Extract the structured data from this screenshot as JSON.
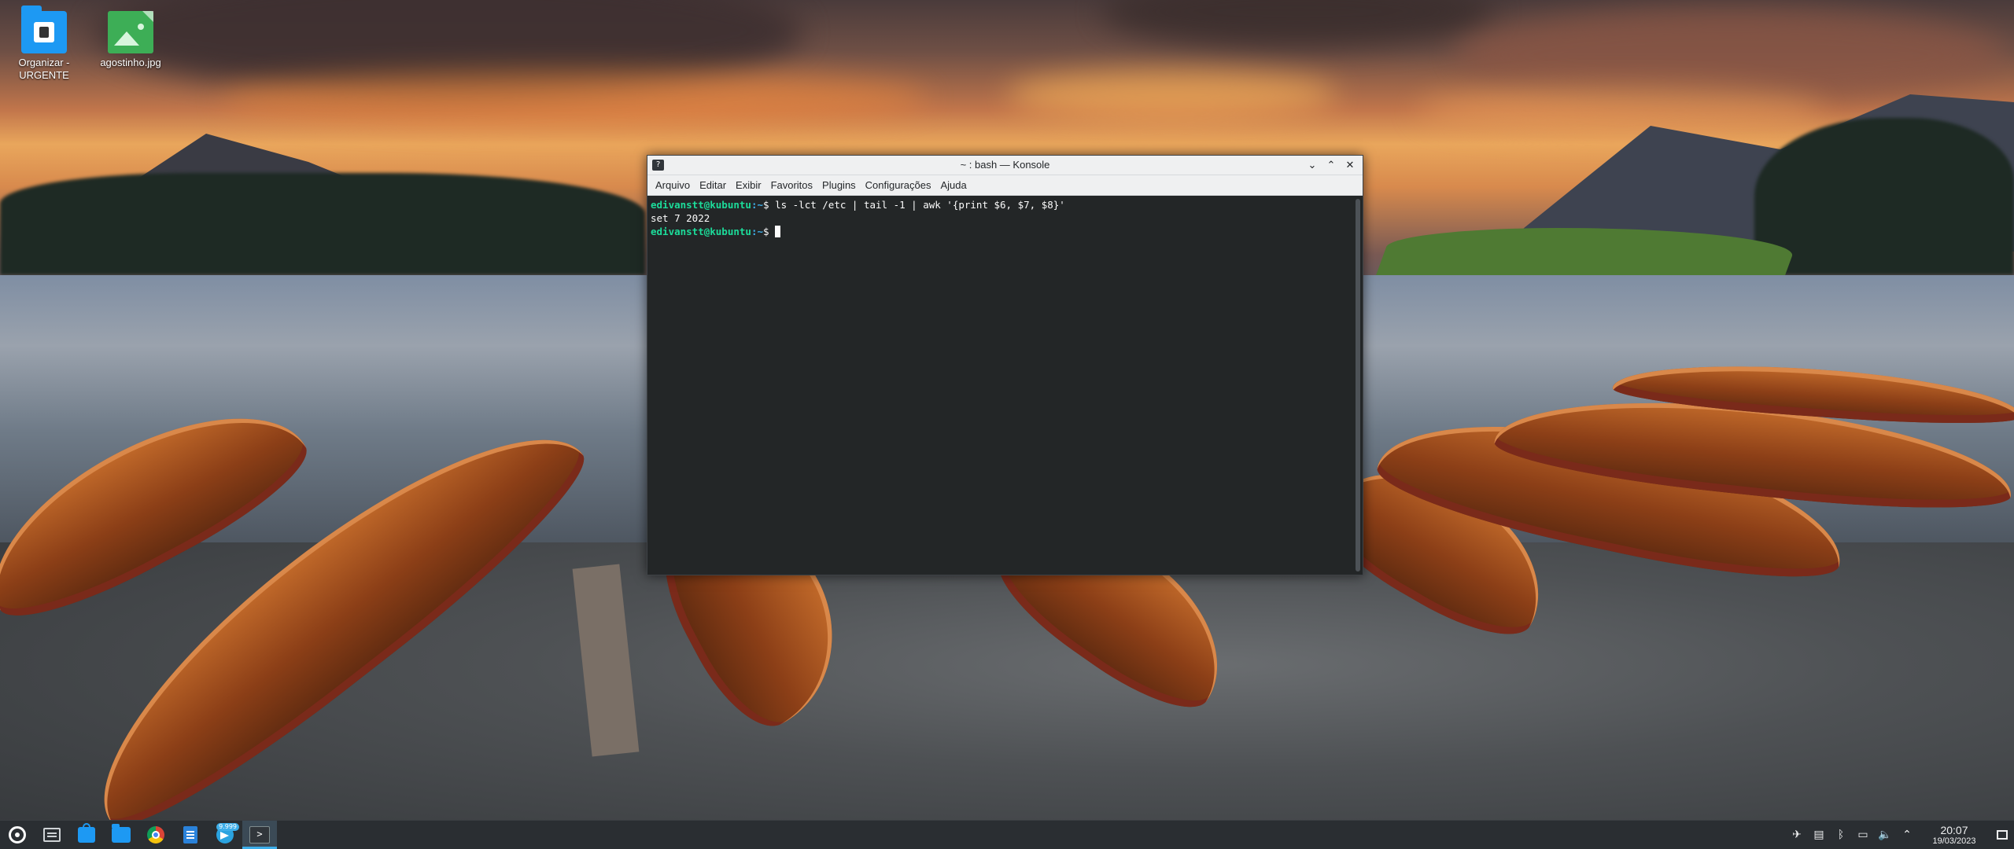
{
  "desktop": {
    "icons": [
      {
        "label": "Organizar - URGENTE",
        "icon": "folder-icon"
      },
      {
        "label": "agostinho.jpg",
        "icon": "image-file-icon"
      }
    ]
  },
  "window": {
    "title": "~ : bash — Konsole",
    "app_icon_glyph": "?",
    "buttons": {
      "minimize": "⌄",
      "maximize": "⌃",
      "close": "✕"
    },
    "menu": [
      "Arquivo",
      "Editar",
      "Exibir",
      "Favoritos",
      "Plugins",
      "Configurações",
      "Ajuda"
    ]
  },
  "terminal": {
    "prompt_user": "edivanstt@kubuntu",
    "prompt_path": ":~",
    "prompt_symbol": "$ ",
    "command": "ls -lct /etc | tail -1 | awk '{print $6, $7, $8}'",
    "output": "set 7 2022",
    "colors": {
      "background": "#232627",
      "foreground": "#fcfcfc",
      "user": "#1cdc9a",
      "path": "#3daee9"
    }
  },
  "taskbar": {
    "items": [
      {
        "name": "application-launcher",
        "icon": "launcher-icon"
      },
      {
        "name": "system-settings",
        "icon": "system-icon"
      },
      {
        "name": "discover-store",
        "icon": "store-icon"
      },
      {
        "name": "dolphin-files",
        "icon": "folder-icon"
      },
      {
        "name": "google-chrome",
        "icon": "chrome-icon"
      },
      {
        "name": "documents",
        "icon": "document-icon"
      },
      {
        "name": "telegram",
        "icon": "telegram-icon",
        "badge": "9.999"
      },
      {
        "name": "konsole",
        "icon": "terminal-icon",
        "active": true,
        "glyph": ">"
      }
    ],
    "tray": {
      "icons": [
        "telegram-tray-icon",
        "clipboard-icon",
        "bluetooth-icon",
        "display-icon",
        "volume-icon",
        "chevron-up-icon"
      ],
      "glyphs": [
        "✈",
        "▤",
        "ᛒ",
        "▭",
        "🔈",
        "⌃"
      ],
      "time": "20:07",
      "date": "19/03/2023"
    },
    "colors": {
      "background": "#2a2e32",
      "accent": "#3daee9"
    }
  }
}
